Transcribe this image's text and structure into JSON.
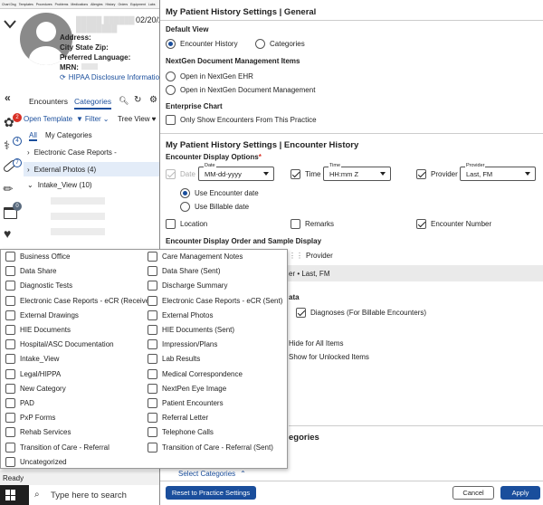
{
  "top_tabs": [
    "Chart Dsg",
    "Templates",
    "Procedures",
    "Problems",
    "Medications",
    "Allergies",
    "History",
    "Orders",
    "Equipment",
    "Labs"
  ],
  "patient": {
    "name_masked": "█████ ██████ ████████",
    "dob_partial": "02/20/20",
    "address_label": "Address:",
    "city_label": "City State Zip:",
    "language_label": "Preferred Language:",
    "mrn_label": "MRN:",
    "hipaa_link": "HIPAA Disclosure Information"
  },
  "left": {
    "tab_encounters": "Encounters",
    "tab_categories": "Categories",
    "open_template": "Open Template",
    "filter": "Filter",
    "tree_view": "Tree View",
    "sub_all": "All",
    "sub_my_categories": "My Categories",
    "tree": [
      {
        "label": "Electronic Case Reports -"
      },
      {
        "label": "External Photos (4)"
      },
      {
        "label": "Intake_View (10)"
      }
    ],
    "badges": {
      "b1": "2",
      "b2": "4",
      "b3": "7",
      "b4": "0"
    },
    "status": "Ready"
  },
  "taskbar": {
    "search_placeholder": "Type here to search"
  },
  "dropdown": {
    "col1": [
      "Business Office",
      "Data Share",
      "Diagnostic Tests",
      "Electronic Case Reports - eCR (Received)",
      "External Drawings",
      "HIE Documents",
      "Hospital/ASC Documentation",
      "Intake_View",
      "Legal/HIPPA",
      "New Category",
      "PAD",
      "PxP Forms",
      "Rehab Services",
      "Transition of Care - Referral",
      "Uncategorized"
    ],
    "col2": [
      "Care Management Notes",
      "Data Share (Sent)",
      "Discharge Summary",
      "Electronic Case Reports - eCR (Sent)",
      "External Photos",
      "HIE Documents (Sent)",
      "Impression/Plans",
      "Lab Results",
      "Medical Correspondence",
      "NextPen Eye Image",
      "Patient Encounters",
      "Referral Letter",
      "Telephone Calls",
      "Transition of Care - Referral (Sent)"
    ]
  },
  "dialog": {
    "title_general": "My Patient History Settings | General",
    "default_view": "Default View",
    "encounter_history": "Encounter History",
    "categories": "Categories",
    "nextgen_doc_items": "NextGen Document Management Items",
    "open_ehr": "Open in NextGen EHR",
    "open_dm": "Open in NextGen Document Management",
    "enterprise_chart": "Enterprise Chart",
    "only_show": "Only Show Encounters From This Practice",
    "title_encounter": "My Patient History Settings | Encounter History",
    "display_options": "Encounter Display Options",
    "required_mark": "*",
    "date_label": "Date",
    "date_cap": "Date",
    "date_format": "MM-dd-yyyy",
    "time_label": "Time",
    "time_cap": "Time",
    "time_format": "HH:mm Z",
    "provider_label": "Provider",
    "provider_cap": "Provider",
    "provider_format": "Last, FM",
    "use_encounter_date": "Use Encounter date",
    "use_billable_date": "Use Billable date",
    "location": "Location",
    "remarks": "Remarks",
    "encounter_number": "Encounter Number",
    "order_heading": "Encounter Display Order and Sample Display",
    "provider_chip": "Provider",
    "sample_tail": "er  •  Last, FM",
    "ata": "ata",
    "diagnoses": "Diagnoses (For Billable Encounters)",
    "hide_all": "Hide for All Items",
    "show_unlocked": "Show for Unlocked Items",
    "categories_partial": "egories",
    "select_categories": "Select Categories",
    "reset": "Reset to Practice Settings",
    "cancel": "Cancel",
    "apply": "Apply"
  },
  "colors": {
    "accent": "#1a4e9c",
    "badge_red": "#d93025",
    "apply_bg": "#1a4e9c"
  }
}
